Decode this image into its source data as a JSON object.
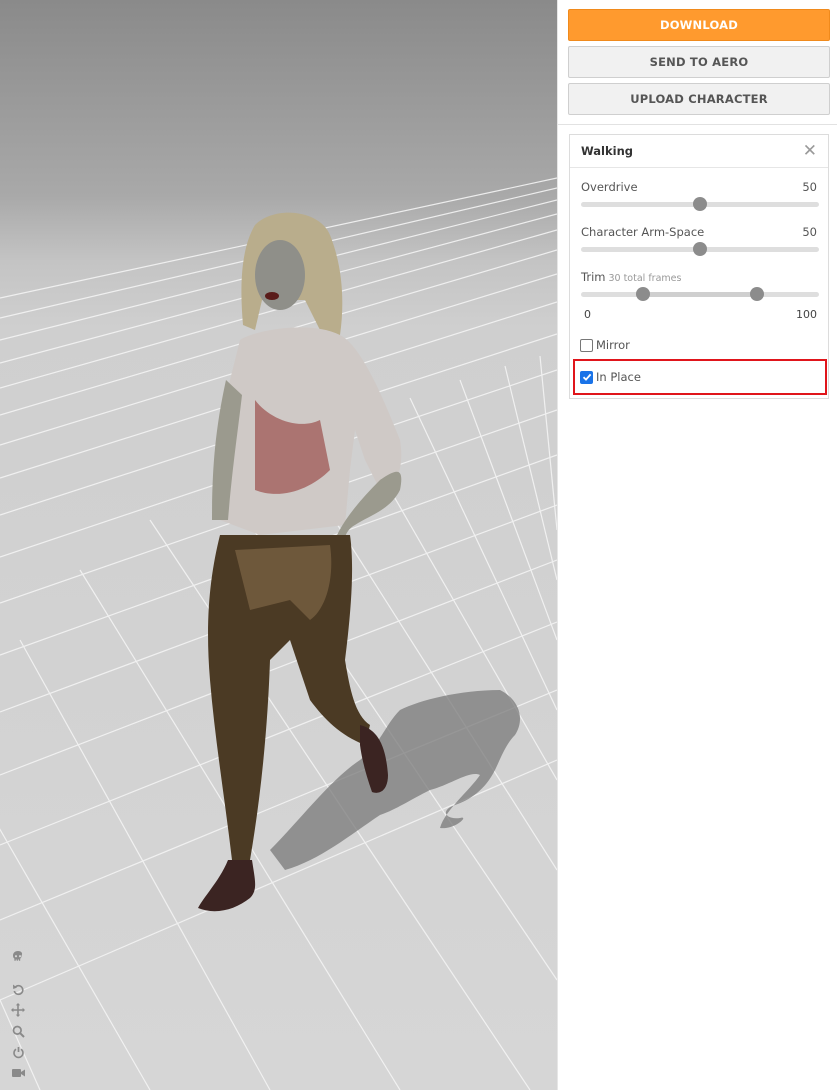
{
  "toolbar": {
    "download_label": "DOWNLOAD",
    "send_label": "SEND TO AERO",
    "upload_label": "UPLOAD CHARACTER"
  },
  "animation_panel": {
    "title": "Walking",
    "close_icon": "close-icon",
    "overdrive": {
      "label": "Overdrive",
      "value": "50",
      "level": 0.5
    },
    "arm_space": {
      "label": "Character Arm-Space",
      "value": "50",
      "level": 0.5
    },
    "trim": {
      "label": "Trim",
      "note": "30 total frames",
      "min_label": "0",
      "max_label": "100",
      "start": 26,
      "end": 74
    },
    "mirror": {
      "label": "Mirror",
      "checked": false
    },
    "in_place": {
      "label": "In Place",
      "checked": true
    }
  },
  "viewport_tools": {
    "icons": [
      "skull-icon",
      "rotate-icon",
      "move-icon",
      "zoom-icon",
      "power-icon",
      "camera-icon"
    ]
  },
  "colors": {
    "primary_button": "#ff9a2e",
    "checkbox_accent": "#1a73e8",
    "highlight_border": "#e0151b"
  }
}
